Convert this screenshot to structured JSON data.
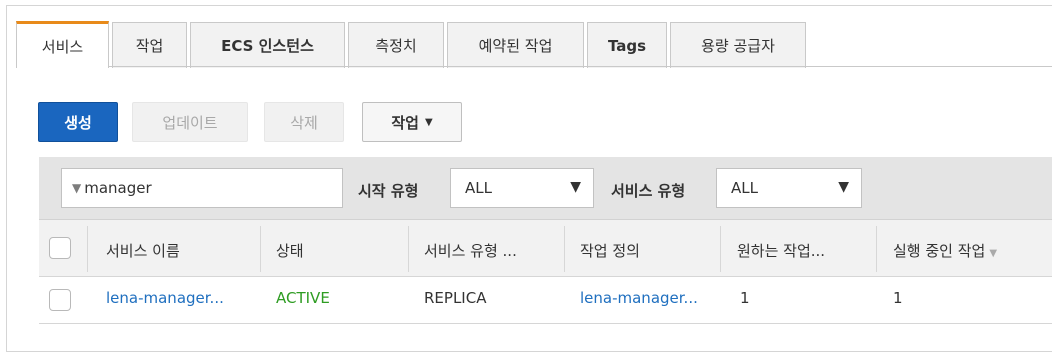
{
  "tabs": [
    {
      "label": "서비스",
      "active": true
    },
    {
      "label": "작업",
      "active": false
    },
    {
      "label": "ECS 인스턴스",
      "active": false
    },
    {
      "label": "측정치",
      "active": false
    },
    {
      "label": "예약된 작업",
      "active": false
    },
    {
      "label": "Tags",
      "active": false
    },
    {
      "label": "용량 공급자",
      "active": false
    }
  ],
  "toolbar": {
    "create_label": "생성",
    "update_label": "업데이트",
    "delete_label": "삭제",
    "actions_label": "작업",
    "actions_caret": "▼"
  },
  "filters": {
    "search_value": "manager",
    "launch_type_label": "시작 유형",
    "launch_type_value": "ALL",
    "service_type_label": "서비스 유형",
    "service_type_value": "ALL",
    "dropdown_arrow": "▼"
  },
  "table": {
    "headers": [
      "서비스 이름",
      "상태",
      "서비스 유형 ...",
      "작업 정의",
      "원하는 작업...",
      "실행 중인 작업"
    ],
    "sort_indicator": "▼",
    "rows": [
      [
        "lena-manager...",
        "ACTIVE",
        "REPLICA",
        "lena-manager...",
        "1",
        "1"
      ]
    ]
  },
  "colors": {
    "primary_button": "#1a66bf",
    "active_tab_accent": "#e88a1a",
    "link": "#1f6fbf",
    "status_active": "#2e9c22"
  }
}
